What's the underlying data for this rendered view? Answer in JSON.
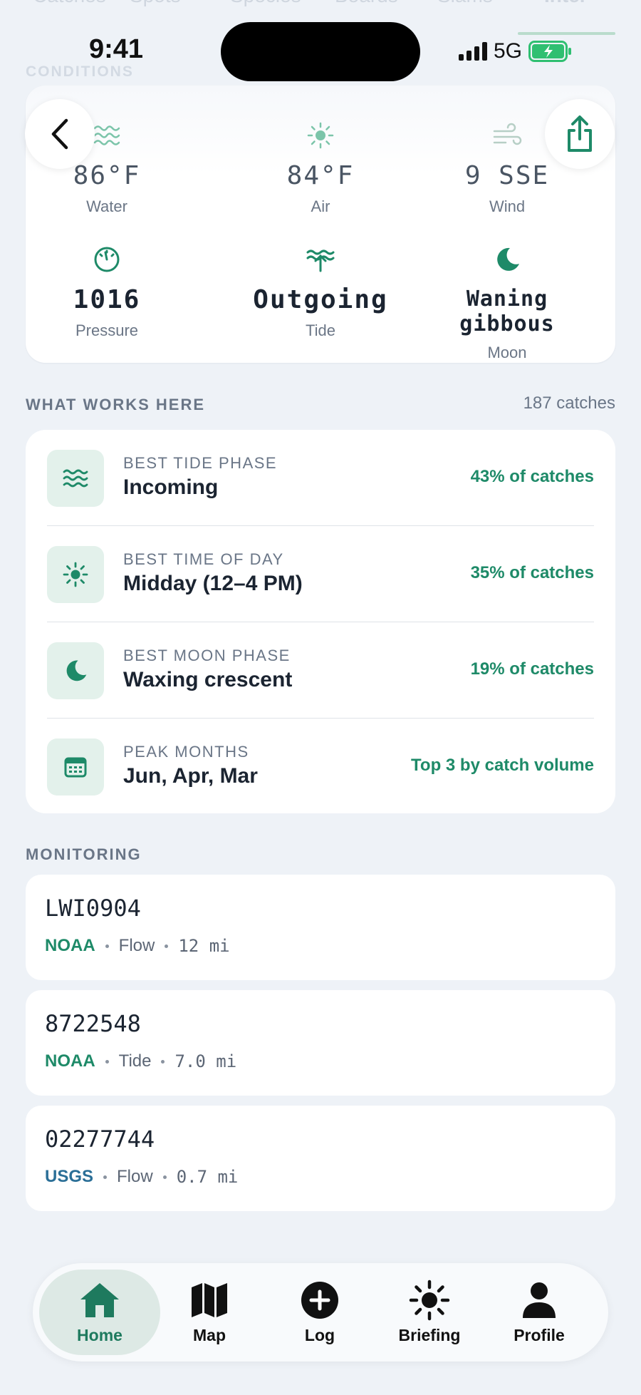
{
  "status_bar": {
    "time": "9:41",
    "network": "5G"
  },
  "top_tabs": [
    "Catches",
    "Spots",
    "Species",
    "Boards",
    "Slams",
    "Intel"
  ],
  "conditions": {
    "section_title": "CONDITIONS",
    "items": [
      {
        "icon": "waves-icon",
        "value": "86°F",
        "label": "Water"
      },
      {
        "icon": "sun-icon",
        "value": "84°F",
        "label": "Air"
      },
      {
        "icon": "wind-icon",
        "value": "9 SSE",
        "label": "Wind"
      },
      {
        "icon": "gauge-icon",
        "value": "1016",
        "label": "Pressure"
      },
      {
        "icon": "tide-outgoing-icon",
        "value": "Outgoing",
        "label": "Tide"
      },
      {
        "icon": "moon-icon",
        "value": "Waning gibbous",
        "label": "Moon"
      }
    ]
  },
  "what_works": {
    "section_title": "WHAT WORKS HERE",
    "count": "187 catches",
    "rows": [
      {
        "icon": "waves-icon",
        "key": "BEST TIDE PHASE",
        "value": "Incoming",
        "stat": "43% of catches"
      },
      {
        "icon": "sun-icon",
        "key": "BEST TIME OF DAY",
        "value": "Midday (12–4 PM)",
        "stat": "35% of catches"
      },
      {
        "icon": "moon-icon",
        "key": "BEST MOON PHASE",
        "value": "Waxing crescent",
        "stat": "19% of catches"
      },
      {
        "icon": "calendar-icon",
        "key": "PEAK MONTHS",
        "value": "Jun, Apr, Mar",
        "stat": "Top 3 by catch volume"
      }
    ]
  },
  "monitoring": {
    "section_title": "MONITORING",
    "stations": [
      {
        "id": "LWI0904",
        "source": "NOAA",
        "source_color": "#1e8a68",
        "type": "Flow",
        "distance": "12 mi"
      },
      {
        "id": "8722548",
        "source": "NOAA",
        "source_color": "#1e8a68",
        "type": "Tide",
        "distance": "7.0 mi"
      },
      {
        "id": "02277744",
        "source": "USGS",
        "source_color": "#2b6f97",
        "type": "Flow",
        "distance": "0.7 mi"
      }
    ]
  },
  "nav": {
    "items": [
      {
        "icon": "home-icon",
        "label": "Home",
        "active": true
      },
      {
        "icon": "map-icon",
        "label": "Map"
      },
      {
        "icon": "plus-circle-icon",
        "label": "Log"
      },
      {
        "icon": "sun-icon",
        "label": "Briefing"
      },
      {
        "icon": "person-icon",
        "label": "Profile"
      }
    ]
  },
  "colors": {
    "accent": "#1e8a68",
    "accent_soft": "#e3f1eb",
    "background": "#eef2f7",
    "usgs": "#2b6f97"
  }
}
